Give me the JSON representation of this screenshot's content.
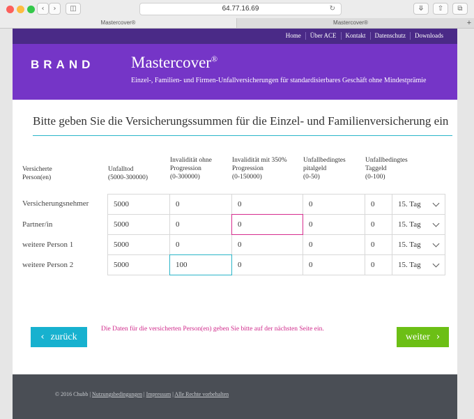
{
  "browser": {
    "url": "64.77.16.69",
    "tabs": [
      "Mastercover®",
      "Mastercover®"
    ],
    "new_tab_symbol": "+"
  },
  "nav": {
    "items": [
      "Home",
      "Über ACE",
      "Kontakt",
      "Datenschutz",
      "Downloads"
    ]
  },
  "header": {
    "brand": "BRAND",
    "title": "Mastercover",
    "title_mark": "®",
    "subtitle": "Einzel-, Familien- und Firmen-Unfallversicherungen für standardisierbares Geschäft ohne Mindestprämie"
  },
  "main": {
    "heading": "Bitte geben Sie die Versicherungssummen für die Einzel- und Familienversicherung ein",
    "columns": [
      {
        "line1": "Versicherte",
        "line2": "Person(en)",
        "line3": ""
      },
      {
        "line1": "Unfalltod",
        "line2": "(5000-300000)",
        "line3": ""
      },
      {
        "line1": "Invalidität ohne",
        "line2": "Progression",
        "line3": "(0-300000)"
      },
      {
        "line1": "Invalidität mit 350%",
        "line2": "Progression",
        "line3": "(0-150000)"
      },
      {
        "line1": "Unfallbedingtes",
        "line2": "pitalgeld",
        "line3": "(0-50)"
      },
      {
        "line1": "Unfallbedingtes",
        "line2": "Taggeld",
        "line3": "(0-100)"
      }
    ],
    "rows": [
      {
        "label": "Versicherungsnehmer",
        "values": [
          "5000",
          "0",
          "0",
          "0",
          "0",
          "15. Tag"
        ]
      },
      {
        "label": "Partner/in",
        "values": [
          "5000",
          "0",
          "0",
          "0",
          "0",
          "15. Tag"
        ]
      },
      {
        "label": "weitere Person 1",
        "values": [
          "5000",
          "0",
          "0",
          "0",
          "0",
          "15. Tag"
        ]
      },
      {
        "label": "weitere Person 2",
        "values": [
          "5000",
          "100",
          "0",
          "0",
          "0",
          "15. Tag"
        ]
      }
    ],
    "back_label": "zurück",
    "next_label": "weiter",
    "notice": "Die Daten für die versicherten Person(en) geben Sie bitte auf der nächsten Seite ein."
  },
  "footer": {
    "copyright": "© 2016 Chubb",
    "links": [
      "Nutzungsbedingungen",
      "Impressum",
      "Alle Rechte vorbehalten"
    ],
    "separator": "|"
  },
  "colors": {
    "nav_bg": "#4a2a87",
    "hero_bg": "#7535c7",
    "accent_teal": "#17b1cf",
    "accent_green": "#6cbf15",
    "notice_pink": "#d02a8b",
    "footer_bg": "#4a4e55"
  },
  "icons": [
    "back-icon",
    "forward-icon",
    "sidebar-icon",
    "reload-icon",
    "download-icon",
    "share-icon",
    "tabs-icon",
    "chevron-left-icon",
    "chevron-right-icon",
    "chevron-down-icon"
  ]
}
